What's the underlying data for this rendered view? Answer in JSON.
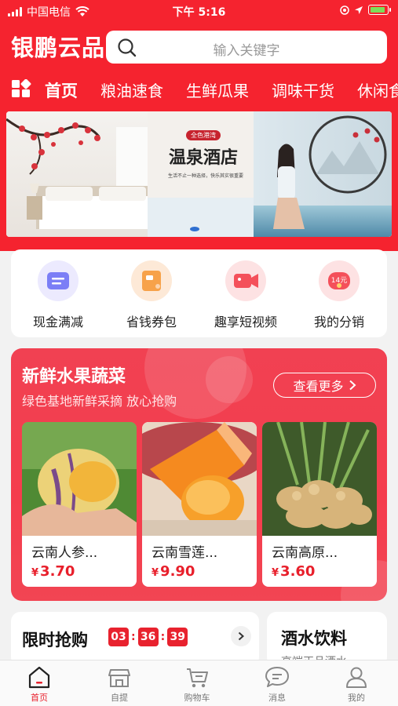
{
  "status_bar": {
    "carrier": "中国电信",
    "time": "下午 5:16"
  },
  "header": {
    "brand": "银鹏云品",
    "search_placeholder": "输入关键字"
  },
  "categories": [
    {
      "label": "首页",
      "active": true
    },
    {
      "label": "粮油速食"
    },
    {
      "label": "生鲜瓜果"
    },
    {
      "label": "调味干货"
    },
    {
      "label": "休闲食"
    }
  ],
  "banner": {
    "tag": "全色港湾",
    "headline": "温泉酒店",
    "tagline": "生活不止一种选择，快乐其实很重要"
  },
  "quick_menu": [
    {
      "label": "现金满减",
      "icon": "wallet-icon",
      "color": "#7b7ef6"
    },
    {
      "label": "省钱券包",
      "icon": "coupon-icon",
      "color": "#f7a24a"
    },
    {
      "label": "趣享短视频",
      "icon": "video-icon",
      "color": "#f4505a"
    },
    {
      "label": "我的分销",
      "icon": "redpacket-icon",
      "color": "#f4505a",
      "badge": "14元"
    }
  ],
  "fresh": {
    "title": "新鲜水果蔬菜",
    "subtitle": "绿色基地新鲜采摘 放心抢购",
    "more": "查看更多",
    "products": [
      {
        "name": "云南人参...",
        "currency": "¥",
        "price": "3.70"
      },
      {
        "name": "云南雪莲...",
        "currency": "¥",
        "price": "9.90"
      },
      {
        "name": "云南高原...",
        "currency": "¥",
        "price": "3.60"
      }
    ]
  },
  "flash_sale": {
    "title": "限时抢购",
    "hours": "03",
    "minutes": "36",
    "seconds": "39",
    "sep": ":"
  },
  "drinks": {
    "title": "酒水饮料",
    "sub": "高端正品酒水"
  },
  "tabbar": [
    {
      "label": "首页",
      "active": true
    },
    {
      "label": "自提"
    },
    {
      "label": "购物车"
    },
    {
      "label": "消息"
    },
    {
      "label": "我的"
    }
  ],
  "colors": {
    "brand_red": "#f5232f",
    "price_red": "#e81f2b"
  }
}
